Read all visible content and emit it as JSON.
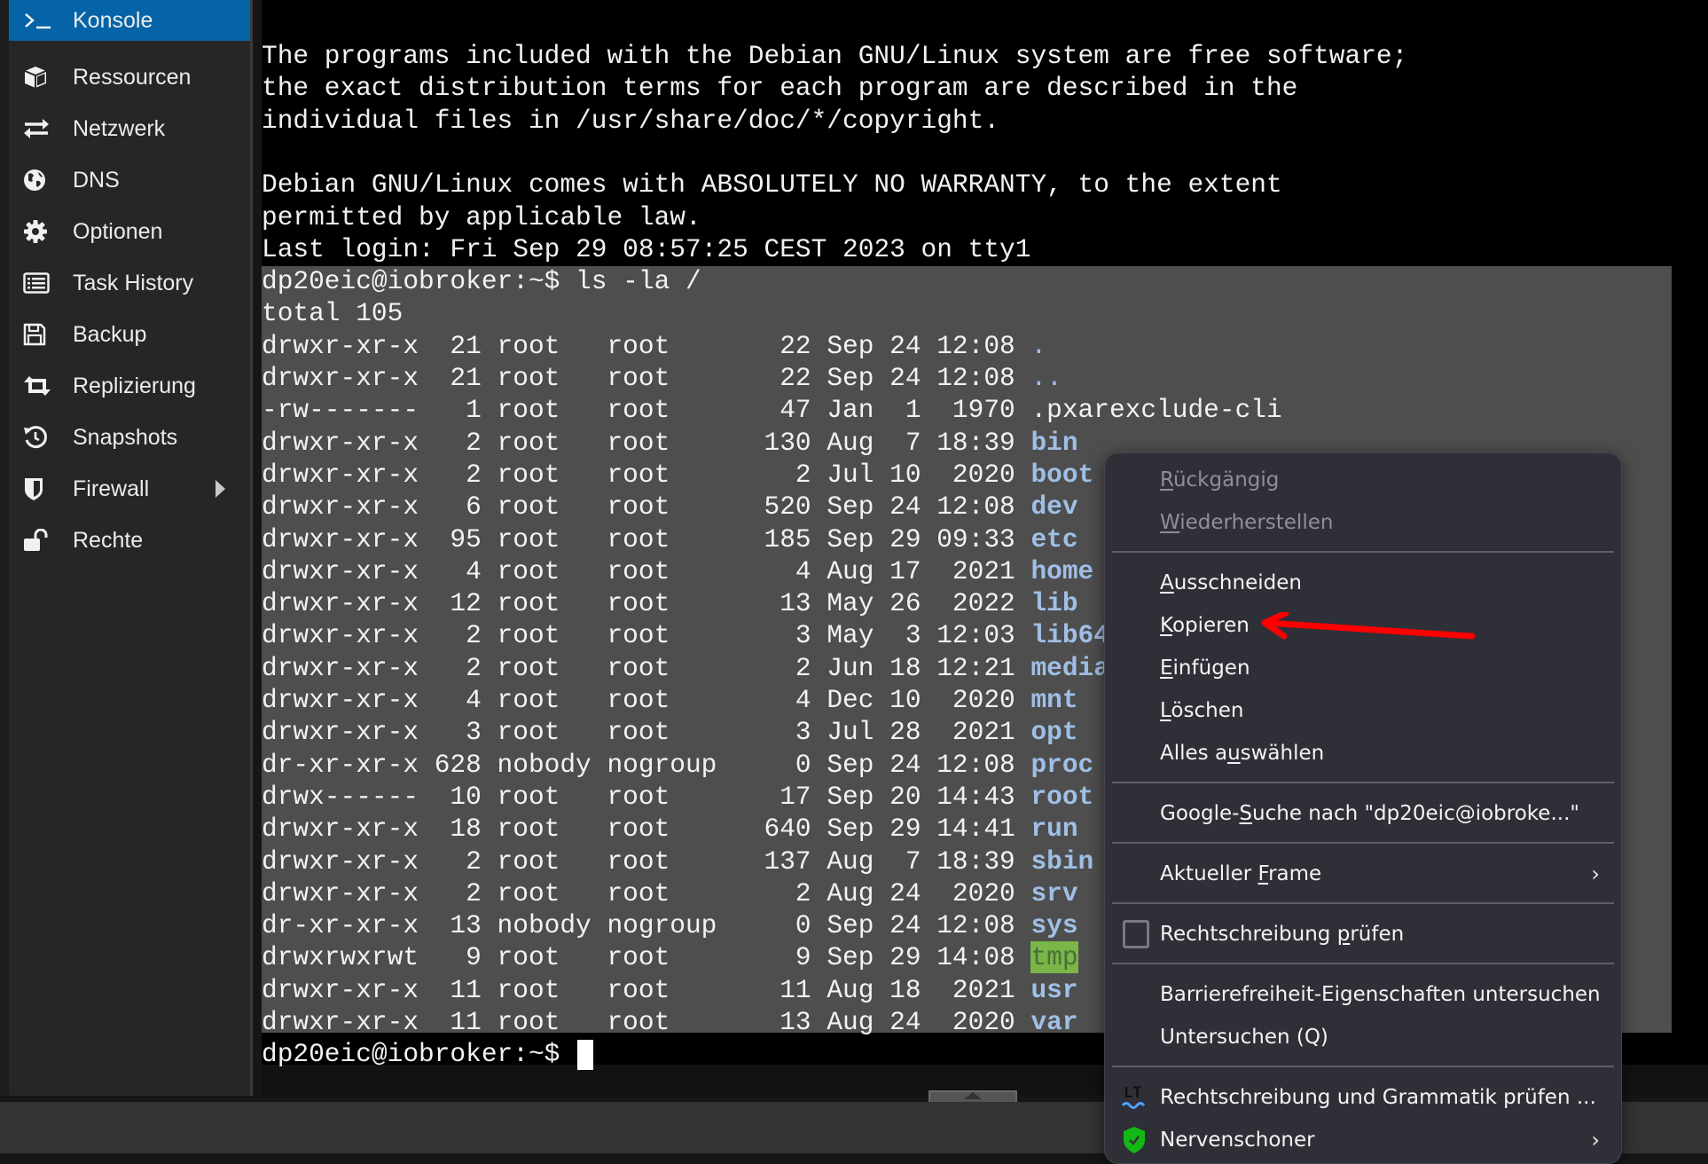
{
  "sidebar": {
    "items": [
      {
        "label": "Konsole",
        "icon": "terminal-icon",
        "active": true
      },
      {
        "label": "Ressourcen",
        "icon": "cube-icon"
      },
      {
        "label": "Netzwerk",
        "icon": "exchange-icon"
      },
      {
        "label": "DNS",
        "icon": "globe-icon"
      },
      {
        "label": "Optionen",
        "icon": "gear-icon"
      },
      {
        "label": "Task History",
        "icon": "list-icon"
      },
      {
        "label": "Backup",
        "icon": "floppy-icon"
      },
      {
        "label": "Replizierung",
        "icon": "retweet-icon"
      },
      {
        "label": "Snapshots",
        "icon": "history-icon"
      },
      {
        "label": "Firewall",
        "icon": "shield-icon",
        "has_submenu": true
      },
      {
        "label": "Rechte",
        "icon": "unlock-icon"
      }
    ]
  },
  "terminal": {
    "motd": [
      "The programs included with the Debian GNU/Linux system are free software;",
      "the exact distribution terms for each program are described in the",
      "individual files in /usr/share/doc/*/copyright.",
      "",
      "Debian GNU/Linux comes with ABSOLUTELY NO WARRANTY, to the extent",
      "permitted by applicable law.",
      "Last login: Fri Sep 29 08:57:25 CEST 2023 on tty1"
    ],
    "command_line": "dp20eic@iobroker:~$ ls -la /",
    "total_line": "total 105",
    "listing": [
      {
        "perms": "drwxr-xr-x",
        "links": "21",
        "owner": "root",
        "group": "root",
        "size": "22",
        "month": "Sep",
        "day": "24",
        "time": "12:08",
        "name": ".",
        "type": "plain"
      },
      {
        "perms": "drwxr-xr-x",
        "links": "21",
        "owner": "root",
        "group": "root",
        "size": "22",
        "month": "Sep",
        "day": "24",
        "time": "12:08",
        "name": "..",
        "type": "plain"
      },
      {
        "perms": "-rw-------",
        "links": "1",
        "owner": "root",
        "group": "root",
        "size": "47",
        "month": "Jan",
        "day": "1",
        "time": "1970",
        "name": ".pxarexclude-cli",
        "type": "file"
      },
      {
        "perms": "drwxr-xr-x",
        "links": "2",
        "owner": "root",
        "group": "root",
        "size": "130",
        "month": "Aug",
        "day": "7",
        "time": "18:39",
        "name": "bin",
        "type": "dir"
      },
      {
        "perms": "drwxr-xr-x",
        "links": "2",
        "owner": "root",
        "group": "root",
        "size": "2",
        "month": "Jul",
        "day": "10",
        "time": "2020",
        "name": "boot",
        "type": "dir"
      },
      {
        "perms": "drwxr-xr-x",
        "links": "6",
        "owner": "root",
        "group": "root",
        "size": "520",
        "month": "Sep",
        "day": "24",
        "time": "12:08",
        "name": "dev",
        "type": "dir"
      },
      {
        "perms": "drwxr-xr-x",
        "links": "95",
        "owner": "root",
        "group": "root",
        "size": "185",
        "month": "Sep",
        "day": "29",
        "time": "09:33",
        "name": "etc",
        "type": "dir"
      },
      {
        "perms": "drwxr-xr-x",
        "links": "4",
        "owner": "root",
        "group": "root",
        "size": "4",
        "month": "Aug",
        "day": "17",
        "time": "2021",
        "name": "home",
        "type": "dir"
      },
      {
        "perms": "drwxr-xr-x",
        "links": "12",
        "owner": "root",
        "group": "root",
        "size": "13",
        "month": "May",
        "day": "26",
        "time": "2022",
        "name": "lib",
        "type": "dir"
      },
      {
        "perms": "drwxr-xr-x",
        "links": "2",
        "owner": "root",
        "group": "root",
        "size": "3",
        "month": "May",
        "day": "3",
        "time": "12:03",
        "name": "lib64",
        "type": "dir"
      },
      {
        "perms": "drwxr-xr-x",
        "links": "2",
        "owner": "root",
        "group": "root",
        "size": "2",
        "month": "Jun",
        "day": "18",
        "time": "12:21",
        "name": "media",
        "type": "dir"
      },
      {
        "perms": "drwxr-xr-x",
        "links": "4",
        "owner": "root",
        "group": "root",
        "size": "4",
        "month": "Dec",
        "day": "10",
        "time": "2020",
        "name": "mnt",
        "type": "dir"
      },
      {
        "perms": "drwxr-xr-x",
        "links": "3",
        "owner": "root",
        "group": "root",
        "size": "3",
        "month": "Jul",
        "day": "28",
        "time": "2021",
        "name": "opt",
        "type": "dir"
      },
      {
        "perms": "dr-xr-xr-x",
        "links": "628",
        "owner": "nobody",
        "group": "nogroup",
        "size": "0",
        "month": "Sep",
        "day": "24",
        "time": "12:08",
        "name": "proc",
        "type": "dir"
      },
      {
        "perms": "drwx------",
        "links": "10",
        "owner": "root",
        "group": "root",
        "size": "17",
        "month": "Sep",
        "day": "20",
        "time": "14:43",
        "name": "root",
        "type": "dir"
      },
      {
        "perms": "drwxr-xr-x",
        "links": "18",
        "owner": "root",
        "group": "root",
        "size": "640",
        "month": "Sep",
        "day": "29",
        "time": "14:41",
        "name": "run",
        "type": "dir"
      },
      {
        "perms": "drwxr-xr-x",
        "links": "2",
        "owner": "root",
        "group": "root",
        "size": "137",
        "month": "Aug",
        "day": "7",
        "time": "18:39",
        "name": "sbin",
        "type": "dir"
      },
      {
        "perms": "drwxr-xr-x",
        "links": "2",
        "owner": "root",
        "group": "root",
        "size": "2",
        "month": "Aug",
        "day": "24",
        "time": "2020",
        "name": "srv",
        "type": "dir"
      },
      {
        "perms": "dr-xr-xr-x",
        "links": "13",
        "owner": "nobody",
        "group": "nogroup",
        "size": "0",
        "month": "Sep",
        "day": "24",
        "time": "12:08",
        "name": "sys",
        "type": "dir"
      },
      {
        "perms": "drwxrwxrwt",
        "links": "9",
        "owner": "root",
        "group": "root",
        "size": "9",
        "month": "Sep",
        "day": "29",
        "time": "14:08",
        "name": "tmp",
        "type": "sticky"
      },
      {
        "perms": "drwxr-xr-x",
        "links": "11",
        "owner": "root",
        "group": "root",
        "size": "11",
        "month": "Aug",
        "day": "18",
        "time": "2021",
        "name": "usr",
        "type": "dir"
      },
      {
        "perms": "drwxr-xr-x",
        "links": "11",
        "owner": "root",
        "group": "root",
        "size": "13",
        "month": "Aug",
        "day": "24",
        "time": "2020",
        "name": "var",
        "type": "dir"
      }
    ],
    "prompt": "dp20eic@iobroker:~$ ",
    "colors": {
      "dir": "#9fbfe6",
      "sticky_bg": "#7ab648",
      "selection": "#4e4e4e"
    }
  },
  "context_menu": {
    "items": [
      {
        "id": "undo",
        "label": "Rückgängig",
        "accel": "R",
        "disabled": true
      },
      {
        "id": "redo",
        "label": "Wiederherstellen",
        "accel": "W",
        "disabled": true
      },
      {
        "sep": true
      },
      {
        "id": "cut",
        "label": "Ausschneiden",
        "accel": "A"
      },
      {
        "id": "copy",
        "label": "Kopieren",
        "accel": "K",
        "highlighted_by_arrow": true
      },
      {
        "id": "paste",
        "label": "Einfügen",
        "accel": "E"
      },
      {
        "id": "delete",
        "label": "Löschen",
        "accel": "L"
      },
      {
        "id": "select-all",
        "label": "Alles auswählen",
        "accel": "u"
      },
      {
        "sep": true
      },
      {
        "id": "google-search",
        "label": "Google-Suche nach \"dp20eic@iobroke...\"",
        "accel": "S"
      },
      {
        "sep": true
      },
      {
        "id": "current-frame",
        "label": "Aktueller Frame",
        "accel": "F",
        "submenu": true
      },
      {
        "sep": true
      },
      {
        "id": "spellcheck",
        "label": "Rechtschreibung prüfen",
        "accel": "p",
        "checkbox": true,
        "checked": false
      },
      {
        "sep": true
      },
      {
        "id": "inspect-a11y",
        "label": "Barrierefreiheit-Eigenschaften untersuchen"
      },
      {
        "id": "inspect",
        "label": "Untersuchen (Q)"
      },
      {
        "sep": true
      },
      {
        "id": "languagetool",
        "label": "Rechtschreibung und Grammatik prüfen ...",
        "icon": "languagetool-icon"
      },
      {
        "id": "nervenschoner",
        "label": "Nervenschoner",
        "icon": "green-shield-icon",
        "submenu": true
      }
    ]
  },
  "annotation": {
    "arrow_color": "#ff0000",
    "points_to": "Kopieren"
  }
}
